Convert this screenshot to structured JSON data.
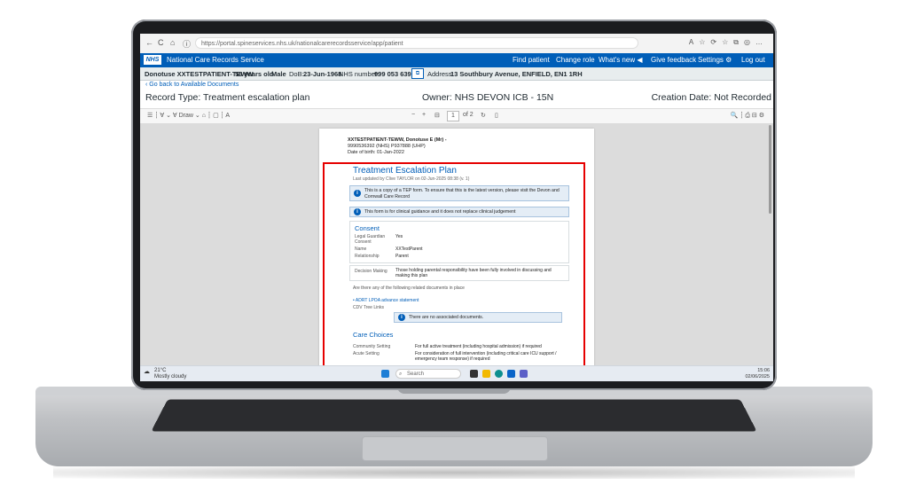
{
  "browser": {
    "url": "https://portal.spineservices.nhs.uk/nationalcarerecordsservice/app/patient",
    "nav": [
      "←",
      "C",
      "⌂",
      "ⓘ"
    ],
    "right_icons": "A☆⟳☆⧉◎…"
  },
  "header": {
    "logo": "NHS",
    "app_title": "National Care Records Service",
    "menu": [
      "Find patient",
      "Change role",
      "What's new ◀",
      "Give feedback",
      "Settings ⚙",
      "Log out"
    ]
  },
  "patient": {
    "name": "Donotuse XXTESTPATIENT-TEWW",
    "age": "56 years old",
    "sex": "Male",
    "dob_label": "DoB:",
    "dob": "23-Jun-1968",
    "nhs_label": "NHS number:",
    "nhs_number": "999 053 6392",
    "address_label": "Address:",
    "address": "13 Southbury Avenue, ENFIELD, EN1 1RH"
  },
  "page": {
    "back_link": "Go back to Available Documents",
    "record_type": "Record Type: Treatment escalation plan",
    "owner": "Owner: NHS DEVON ICB - 15N",
    "creation_date": "Creation Date: Not Recorded"
  },
  "pdf_toolbar": {
    "left": "☰ ┆ ∀ ⌄  ∀ Draw ⌄  ⌂ ┆ ▢ ┆ A",
    "center_minus": "−",
    "center_plus": "+",
    "page_current": "1",
    "page_of": "of 2",
    "right": "🔍 ┆ ⎙ ⊟ ⚙"
  },
  "document": {
    "patient_line": "XXTESTPATIENT-TEWW, Donotuse E (Mr) -",
    "ids_line": "9990536392 (NHS) P937888 (UHP)",
    "dob_line": "Date of birth: 01-Jan-2022",
    "title": "Treatment Escalation Plan",
    "updated": "Last updated by Clive TAYLOR on 02-Jun-2025 08:38 (v. 1)",
    "notice1": "This is a copy of a TEP form. To ensure that this is the latest version, please visit the Devon and Cornwall Care Record",
    "notice2": "This form is for clinical guidance and it does not replace clinical judgement",
    "consent_heading": "Consent",
    "consent_rows": [
      {
        "label": "Legal Guardian Consent",
        "value": "Yes"
      },
      {
        "label": "Name",
        "value": "XXTestParent"
      },
      {
        "label": "Relationship",
        "value": "Parent"
      }
    ],
    "decision_label": "Decision Making",
    "decision_value": "Those holding parental responsibility have been fully involved in discussing and making this plan",
    "related_q": "Are there any of the following related documents in place",
    "related_link": "ADRT LPOA advance statement",
    "cdv_label": "CDV Tree Links",
    "no_docs": "There are no associated documents.",
    "care_heading": "Care Choices",
    "care_rows": [
      {
        "label": "Community Setting",
        "value": "For full active treatment (including hospital admission) if required"
      },
      {
        "label": "Acute Setting",
        "value": "For consideration of full intervention (including critical care ICU support / emergency team response) if required"
      }
    ]
  },
  "taskbar": {
    "weather_temp": "21°C",
    "weather_desc": "Mostly cloudy",
    "search": "Search",
    "time": "15:06",
    "date": "02/06/2025"
  }
}
